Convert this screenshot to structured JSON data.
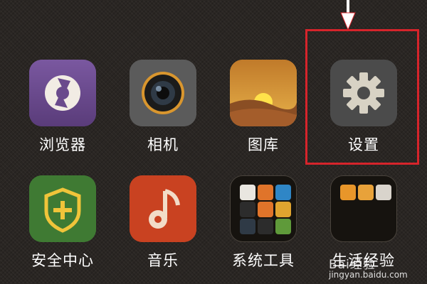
{
  "apps": [
    {
      "label": "浏览器",
      "icon": "browser-icon",
      "color": "#6a4a8c"
    },
    {
      "label": "相机",
      "icon": "camera-icon",
      "color": "#5b5b5b"
    },
    {
      "label": "图库",
      "icon": "gallery-icon",
      "color": "#d68b2b"
    },
    {
      "label": "设置",
      "icon": "gear-icon",
      "color": "#4b4b4b"
    },
    {
      "label": "安全中心",
      "icon": "security-shield-icon",
      "color": "#3f7a33"
    },
    {
      "label": "音乐",
      "icon": "music-note-icon",
      "color": "#c94221"
    },
    {
      "label": "系统工具",
      "icon": "system-tools-folder-icon",
      "color": "#16130f"
    },
    {
      "label": "生活经验",
      "icon": "life-folder-icon",
      "color": "#16130f"
    }
  ],
  "annotation": {
    "highlight_color": "#d6242b",
    "arrow": "down-arrow-icon"
  },
  "watermark": {
    "top": "Bai经验",
    "bottom": "jingyan.baidu.com"
  }
}
